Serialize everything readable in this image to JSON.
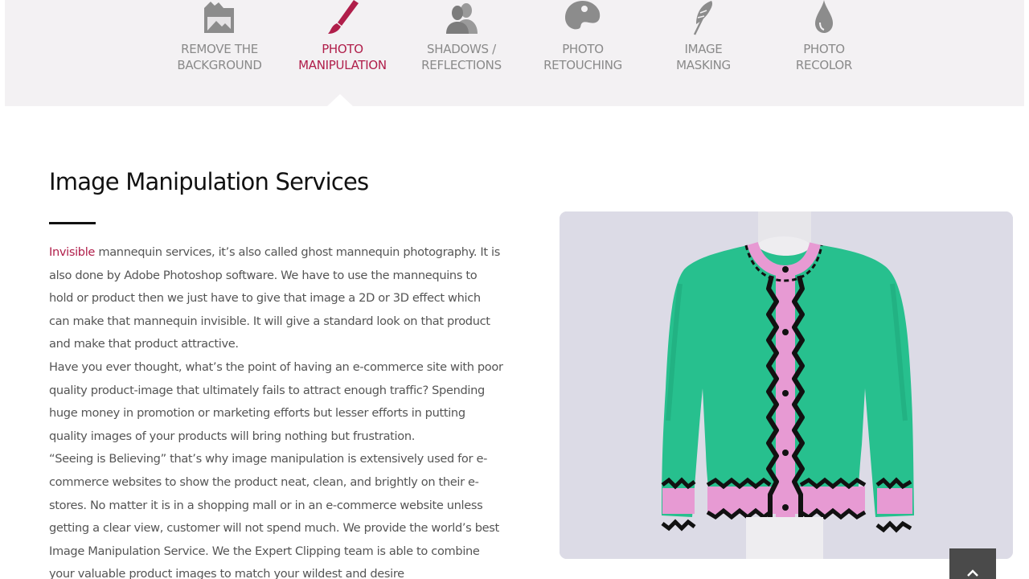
{
  "tabs": [
    {
      "label": "REMOVE THE\nBACKGROUND",
      "icon": "image-frame-icon",
      "active": false
    },
    {
      "label": "PHOTO\nMANIPULATION",
      "icon": "paintbrush-icon",
      "active": true
    },
    {
      "label": "SHADOWS /\nREFLECTIONS",
      "icon": "people-icon",
      "active": false
    },
    {
      "label": "PHOTO\nRETOUCHING",
      "icon": "palette-icon",
      "active": false
    },
    {
      "label": "IMAGE\nMASKING",
      "icon": "feather-icon",
      "active": false
    },
    {
      "label": "PHOTO\nRECOLOR",
      "icon": "drop-icon",
      "active": false
    }
  ],
  "section": {
    "title": "Image Manipulation Services",
    "highlight": "Invisible",
    "paragraph_1": " mannequin services, it’s also called ghost mannequin photography. It is also done by Adobe Photoshop software. We have to use the mannequins to hold or product then we just have to give that image a 2D or 3D effect which can make that mannequin invisible. It will give a standard look on that product and make that product attractive.",
    "paragraph_2": "Have you ever thought, what’s the point of having an e-commerce site with poor quality product-image that ultimately fails to attract enough traffic? Spending huge money in promotion or marketing efforts but lesser efforts in putting quality images of your products will bring nothing but frustration.",
    "paragraph_3": "“Seeing is Believing” that’s why image manipulation is extensively used for e-commerce websites to show the product neat, clean, and brightly on their e-stores. No matter it is in a shopping mall or in an e-commerce website unless getting a clear view, customer will not spend much. We provide the world’s best Image Manipulation Service. We the Expert Clipping team is able to combine your valuable product images to match your wildest and desire"
  },
  "colors": {
    "accent": "#b01e4a",
    "tab_bar_bg": "#f3f1f3",
    "tab_text": "#8a8a8a",
    "icon_gray": "#8c8c8c",
    "cardigan_green": "#27c08e",
    "trim_pink": "#e79ad3",
    "image_bg": "#dcdbe6",
    "scroll_button": "#4a4a4a"
  },
  "image": {
    "subject": "green-cardigan-on-mannequin"
  },
  "scroll_top_icon": "chevron-up-icon"
}
